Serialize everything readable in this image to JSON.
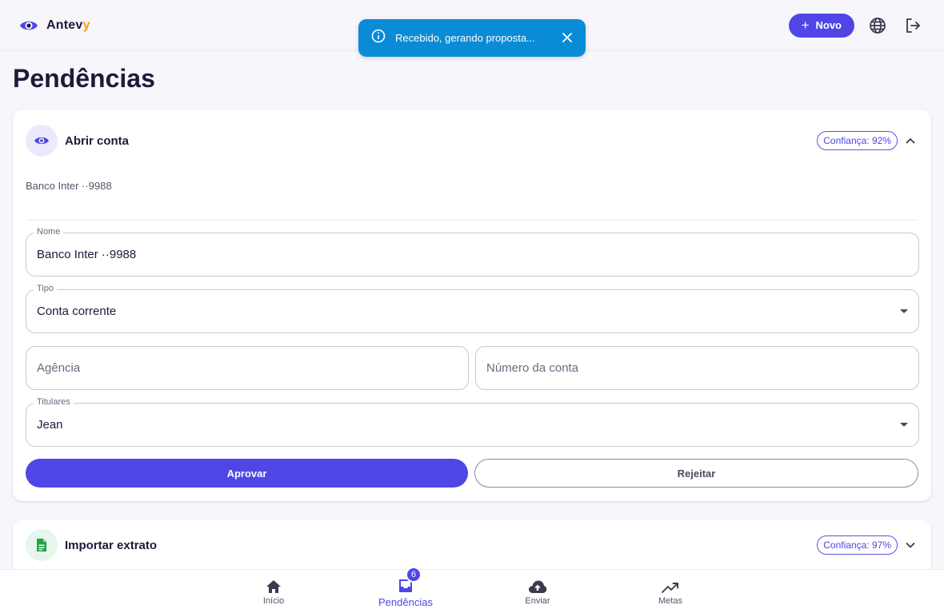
{
  "app": {
    "brand_main": "Antev",
    "brand_accent": "y"
  },
  "header": {
    "new_label": "Novo"
  },
  "toast": {
    "message": "Recebido, gerando proposta..."
  },
  "page": {
    "title": "Pendências"
  },
  "cards": [
    {
      "title": "Abrir conta",
      "confidence": "Confiança: 92%",
      "subtitle": "Banco Inter ··9988",
      "form": {
        "name": {
          "label": "Nome",
          "value": "Banco Inter ··9988"
        },
        "type": {
          "label": "Tipo",
          "value": "Conta corrente"
        },
        "agency": {
          "placeholder": "Agência"
        },
        "account_number": {
          "placeholder": "Número da conta"
        },
        "holders": {
          "label": "Titulares",
          "value": "Jean"
        }
      },
      "approve_label": "Aprovar",
      "reject_label": "Rejeitar"
    },
    {
      "title": "Importar extrato",
      "confidence": "Confiança: 97%"
    }
  ],
  "bottom_nav": {
    "items": [
      {
        "label": "Início",
        "icon": "home-icon"
      },
      {
        "label": "Pendências",
        "icon": "inbox-icon",
        "badge": "6",
        "active": true
      },
      {
        "label": "Enviar",
        "icon": "upload-cloud-icon"
      },
      {
        "label": "Metas",
        "icon": "trending-up-icon"
      }
    ]
  },
  "colors": {
    "primary": "#4f46e5",
    "toast": "#0a8bd6",
    "brand_accent": "#f59e0b",
    "doc_icon": "#22a34a"
  }
}
